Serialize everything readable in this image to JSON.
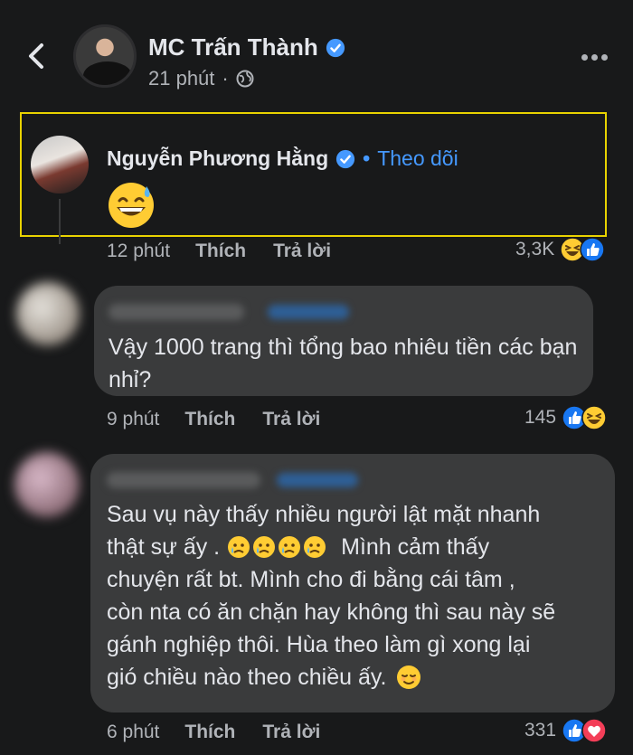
{
  "header": {
    "author": "MC Trấn Thành",
    "time": "21 phút",
    "icons": [
      "back-arrow-icon",
      "verified-icon",
      "globe-icon",
      "more-icon"
    ]
  },
  "comments": [
    {
      "name": "Nguyễn Phương Hằng",
      "separator": "•",
      "follow": "Theo dõi",
      "time": "12 phút",
      "like": "Thích",
      "reply": "Trả lời",
      "reaction_count": "3,3K",
      "reaction_icons": [
        "haha-icon",
        "like-icon"
      ],
      "content_icon": "sweat-smile-emoji"
    },
    {
      "text": "Vậy 1000 trang thì tổng bao nhiêu tiền các bạn nhỉ?",
      "time": "9 phút",
      "like": "Thích",
      "reply": "Trả lời",
      "reaction_count": "145",
      "reaction_icons": [
        "like-icon",
        "haha-icon"
      ]
    },
    {
      "text_lines": [
        "Sau vụ này thấy nhiều người lật mặt nhanh",
        "thật sự ấy .",
        "Mình cảm thấy",
        "chuyện rất bt. Mình cho đi bằng cái tâm ,",
        "còn nta có ăn chặn hay không thì sau này sẽ",
        "gánh nghiệp thôi. Hùa theo làm gì xong lại",
        "gió chiều nào theo chiều ấy."
      ],
      "time": "6 phút",
      "like": "Thích",
      "reply": "Trả lời",
      "reaction_count": "331",
      "reaction_icons": [
        "like-icon",
        "love-icon"
      ]
    }
  ],
  "colors": {
    "background": "#18191a",
    "bubble": "#3a3b3c",
    "link_blue": "#4599ff",
    "highlight": "#e8d200"
  }
}
